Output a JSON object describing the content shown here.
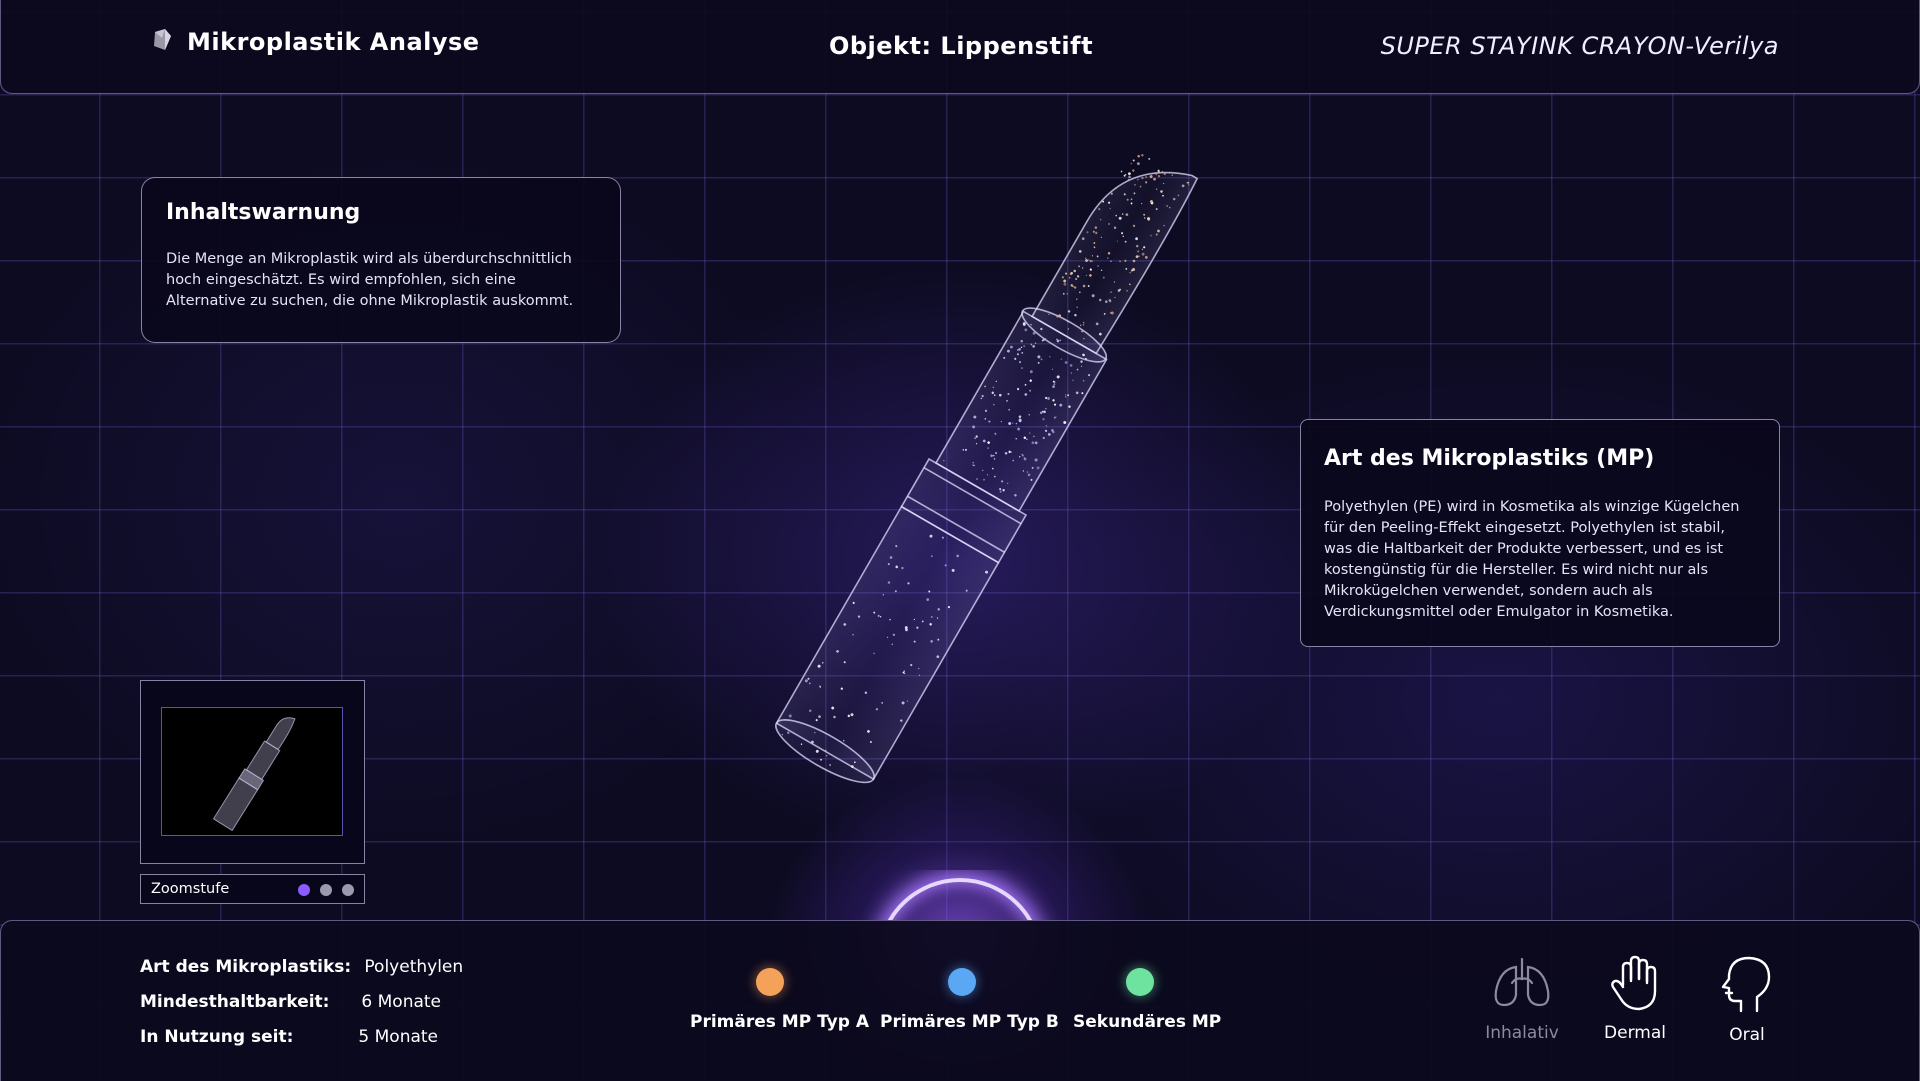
{
  "header": {
    "app_title": "Mikroplastik Analyse",
    "object_title": "Objekt: Lippenstift",
    "product_name": "SUPER STAYINK CRAYON-Verilya",
    "logo_icon": "crystal-icon"
  },
  "warning_card": {
    "title": "Inhaltswarnung",
    "text": "Die Menge an Mikroplastik wird als überdurchschnittlich hoch eingeschätzt. Es wird empfohlen, sich eine Alternative zu suchen, die ohne Mikroplastik auskommt."
  },
  "mp_card": {
    "title": "Art des Mikroplastiks (MP)",
    "text": "Polyethylen (PE) wird in Kosmetika als winzige Kügelchen für den Peeling-Effekt eingesetzt. Polyethylen ist stabil, was die Haltbarkeit der Produkte verbessert, und es ist kostengünstig für die Hersteller. Es wird nicht nur als Mikrokügelchen verwendet, sondern auch als Verdickungsmittel oder Emulgator in Kosmetika."
  },
  "zoom": {
    "label": "Zoomstufe",
    "levels": 3,
    "active_level": 1,
    "active_color": "#8a5cff",
    "inactive_color": "#9b98b0"
  },
  "info": [
    {
      "label": "Art des Mikroplastiks:",
      "value": "Polyethylen"
    },
    {
      "label": "Mindesthaltbarkeit:",
      "value": "6 Monate"
    },
    {
      "label": "In Nutzung seit:",
      "value": "5 Monate"
    }
  ],
  "legend": [
    {
      "label": "Primäres MP Typ A",
      "color": "#f4a15a"
    },
    {
      "label": "Primäres MP Typ B",
      "color": "#5aa8f4"
    },
    {
      "label": "Sekundäres MP",
      "color": "#6ee3a0"
    }
  ],
  "routes": [
    {
      "label": "Inhalativ",
      "icon": "lungs-icon",
      "active": false
    },
    {
      "label": "Dermal",
      "icon": "hand-icon",
      "active": true
    },
    {
      "label": "Oral",
      "icon": "head-icon",
      "active": true
    }
  ]
}
